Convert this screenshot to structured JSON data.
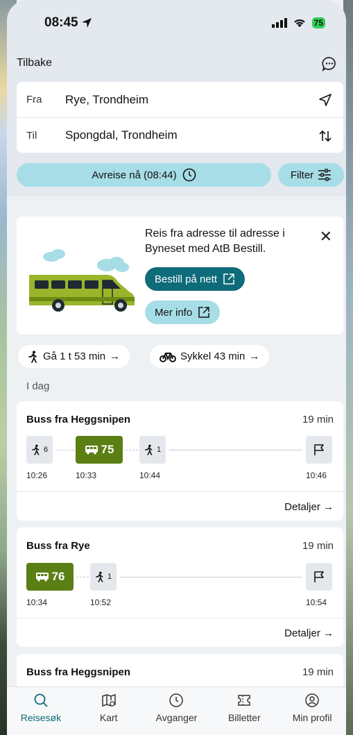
{
  "status": {
    "time": "08:45",
    "battery": "75"
  },
  "header": {
    "back_label": "Tilbake"
  },
  "search": {
    "from_label": "Fra",
    "from_value": "Rye, Trondheim",
    "to_label": "Til",
    "to_value": "Spongdal, Trondheim",
    "departure_label": "Avreise nå (08:44)",
    "filter_label": "Filter"
  },
  "promo": {
    "text": "Reis fra adresse til adresse i Byneset med AtB Bestill.",
    "order_button": "Bestill på nett",
    "info_button": "Mer info"
  },
  "alternatives": {
    "walk": "Gå 1 t 53 min",
    "bike": "Sykkel 43 min"
  },
  "day_label": "I dag",
  "trips": [
    {
      "title": "Buss fra Heggsnipen",
      "duration": "19 min",
      "walk1_min": "6",
      "bus_line": "75",
      "walk2_min": "1",
      "times": [
        "10:26",
        "10:33",
        "10:44",
        "10:46"
      ],
      "details": "Detaljer"
    },
    {
      "title": "Buss fra Rye",
      "duration": "19 min",
      "bus_line": "76",
      "walk_min": "1",
      "times": [
        "10:34",
        "10:52",
        "10:54"
      ],
      "details": "Detaljer"
    },
    {
      "title": "Buss fra Heggsnipen",
      "duration": "19 min"
    }
  ],
  "tabs": [
    {
      "label": "Reisesøk",
      "icon": "search-icon"
    },
    {
      "label": "Kart",
      "icon": "map-icon"
    },
    {
      "label": "Avganger",
      "icon": "clock-icon"
    },
    {
      "label": "Billetter",
      "icon": "ticket-icon"
    },
    {
      "label": "Min profil",
      "icon": "profile-icon"
    }
  ],
  "colors": {
    "accent": "#0e6b7a",
    "button_light": "#a7dde6",
    "bus": "#5b7f14"
  }
}
